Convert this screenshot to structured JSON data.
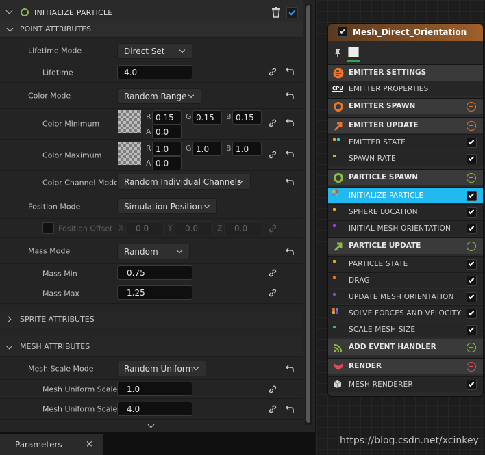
{
  "details": {
    "header": {
      "title": "INITIALIZE PARTICLE",
      "enabled": true
    },
    "sections": {
      "point": "POINT ATTRIBUTES",
      "sprite": "SPRITE ATTRIBUTES",
      "mesh": "MESH ATTRIBUTES"
    },
    "rows": {
      "lifetime_mode": {
        "label": "Lifetime Mode",
        "value": "Direct Set"
      },
      "lifetime": {
        "label": "Lifetime",
        "value": "4.0"
      },
      "color_mode": {
        "label": "Color Mode",
        "value": "Random Range"
      },
      "color_min": {
        "label": "Color Minimum",
        "r_label": "R",
        "r": "0.15",
        "g_label": "G",
        "g": "0.15",
        "b_label": "B",
        "b": "0.15",
        "a_label": "A",
        "a": "0.0"
      },
      "color_max": {
        "label": "Color Maximum",
        "r_label": "R",
        "r": "1.0",
        "g_label": "G",
        "g": "1.0",
        "b_label": "B",
        "b": "1.0",
        "a_label": "A",
        "a": "0.0"
      },
      "color_channel_mode": {
        "label": "Color Channel Mode",
        "value": "Random Individual Channels"
      },
      "position_mode": {
        "label": "Position Mode",
        "value": "Simulation Position"
      },
      "position_offset": {
        "label": "Position Offset",
        "x_label": "X",
        "x": "0.0",
        "y_label": "Y",
        "y": "0.0",
        "z_label": "Z",
        "z": "0.0"
      },
      "mass_mode": {
        "label": "Mass Mode",
        "value": "Random"
      },
      "mass_min": {
        "label": "Mass Min",
        "value": "0.75"
      },
      "mass_max": {
        "label": "Mass Max",
        "value": "1.25"
      },
      "mesh_scale_mode": {
        "label": "Mesh Scale Mode",
        "value": "Random Uniform"
      },
      "mesh_scale_min": {
        "label": "Mesh Uniform Scale",
        "value": "1.0"
      },
      "mesh_scale_max": {
        "label": "Mesh Uniform Scale",
        "value": "4.0"
      }
    },
    "bottom_tab": {
      "label": "Parameters",
      "close": "×"
    }
  },
  "node": {
    "title": "Mesh_Direct_Orientation",
    "stages": [
      {
        "label": "EMITTER SETTINGS",
        "icon": "emitter-settings-icon"
      },
      {
        "label": "EMITTER SPAWN",
        "icon": "emitter-spawn-icon"
      },
      {
        "label": "EMITTER UPDATE",
        "icon": "emitter-update-icon"
      },
      {
        "label": "PARTICLE SPAWN",
        "icon": "particle-spawn-icon"
      },
      {
        "label": "PARTICLE UPDATE",
        "icon": "particle-update-icon"
      },
      {
        "label": "ADD EVENT HANDLER",
        "icon": "event-handler-icon"
      },
      {
        "label": "RENDER",
        "icon": "render-icon"
      }
    ],
    "modules": {
      "emitter_properties": "EMITTER PROPERTIES",
      "emitter_state": "EMITTER STATE",
      "spawn_rate": "SPAWN RATE",
      "initialize_particle": "INITIALIZE PARTICLE",
      "sphere_location": "SPHERE LOCATION",
      "initial_mesh_orientation": "INITIAL MESH ORIENTATION",
      "particle_state": "PARTICLE STATE",
      "drag": "DRAG",
      "update_mesh_orientation": "UPDATE MESH ORIENTATION",
      "solve_forces": "SOLVE FORCES AND VELOCITY",
      "scale_mesh_size": "SCALE MESH SIZE",
      "mesh_renderer": "MESH RENDERER"
    },
    "cpu_label": "CPU",
    "selected_color": "#22b8f0",
    "accent_orange": "#e8752a",
    "accent_green": "#8bbf3d"
  },
  "watermark": "https://blog.csdn.net/xcinkey"
}
